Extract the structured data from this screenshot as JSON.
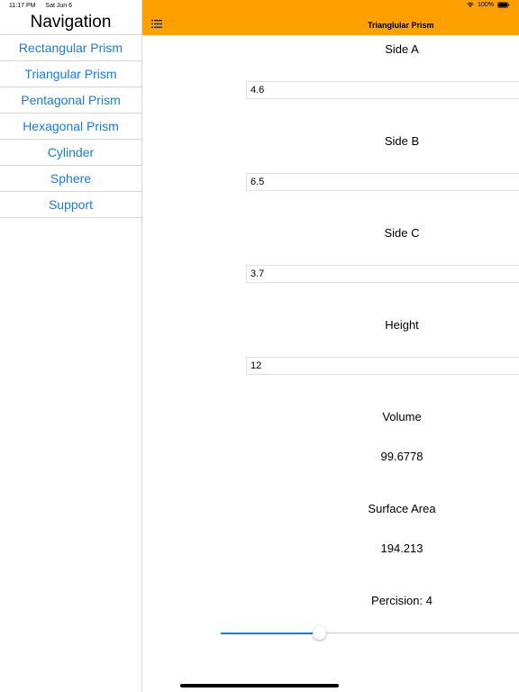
{
  "status": {
    "time": "11:17 PM",
    "date": "Sat Jun 6",
    "battery": "100%"
  },
  "sidebar": {
    "title": "Navigation",
    "items": [
      {
        "label": "Rectangular Prism"
      },
      {
        "label": "Triangular Prism"
      },
      {
        "label": "Pentagonal Prism"
      },
      {
        "label": "Hexagonal Prism"
      },
      {
        "label": "Cylinder"
      },
      {
        "label": "Sphere"
      },
      {
        "label": "Support"
      }
    ]
  },
  "header": {
    "title": "Trianglular Prism",
    "menu_icon": "list-icon",
    "color": "#ff9f00"
  },
  "fields": {
    "side_a": {
      "label": "Side A",
      "value": "4.6"
    },
    "side_b": {
      "label": "Side B",
      "value": "6.5"
    },
    "side_c": {
      "label": "Side C",
      "value": "3.7"
    },
    "height": {
      "label": "Height",
      "value": "12"
    }
  },
  "results": {
    "volume_label": "Volume",
    "volume_value": "99.6778",
    "surface_label": "Surface Area",
    "surface_value": "194.213",
    "precision_label": "Percision: 4"
  },
  "slider": {
    "accent": "#1a7be6",
    "fraction": 0.33
  },
  "colors": {
    "link": "#1a7be6"
  }
}
